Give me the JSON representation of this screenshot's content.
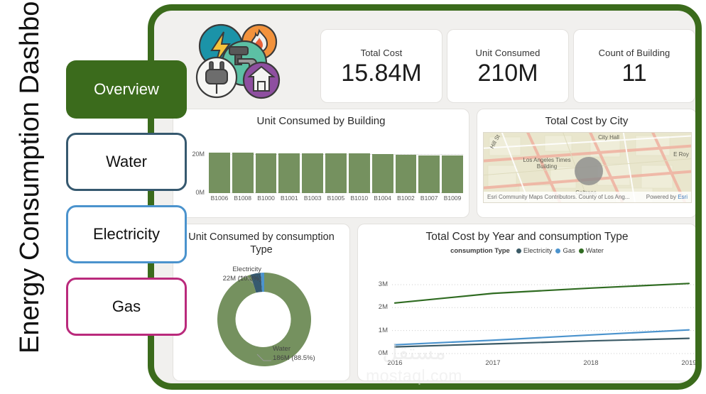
{
  "page": {
    "title": "Energy Consumption Dashboard"
  },
  "nav": {
    "items": [
      {
        "label": "Overview",
        "state": "active",
        "color": "#3b6b1c"
      },
      {
        "label": "Water",
        "state": "inactive",
        "color": "#36596f"
      },
      {
        "label": "Electricity",
        "state": "inactive",
        "color": "#4b93cd"
      },
      {
        "label": "Gas",
        "state": "inactive",
        "color": "#ba2a7c"
      }
    ]
  },
  "kpis": [
    {
      "label": "Total Cost",
      "value": "15.84M"
    },
    {
      "label": "Unit Consumed",
      "value": "210M"
    },
    {
      "label": "Count of Building",
      "value": "11"
    }
  ],
  "icon_cluster": {
    "icons": [
      "lightning-bolt-icon",
      "flame-icon",
      "faucet-icon",
      "plug-icon",
      "house-icon"
    ],
    "colors": [
      "#1b93a8",
      "#f2923c",
      "#5cc0a4",
      "#f6f6f4",
      "#8e4fa0"
    ]
  },
  "map_panel": {
    "title": "Total Cost by City",
    "labels": [
      "City Hall",
      "Los Angeles Times Building",
      "Caltrans",
      "Hill St",
      "E Roy"
    ],
    "attribution": "Esri Community Maps Contributors. County of Los Ang...",
    "powered_by": "Powered by",
    "powered_by_link": "Esri"
  },
  "watermark": {
    "arabic": "مستقل",
    "latin": "mostaql.com"
  },
  "chart_data": [
    {
      "type": "bar",
      "title": "Unit Consumed by Building",
      "xlabel": "",
      "ylabel": "",
      "ylim": [
        0,
        22000000
      ],
      "ytick_labels": [
        "0M",
        "20M"
      ],
      "ytick_values": [
        0,
        20000000
      ],
      "grid": true,
      "categories": [
        "B1006",
        "B1008",
        "B1000",
        "B1001",
        "B1003",
        "B1005",
        "B1010",
        "B1004",
        "B1002",
        "B1007",
        "B1009"
      ],
      "values": [
        20.3,
        20.2,
        19.9,
        19.9,
        19.8,
        19.8,
        19.7,
        19.6,
        19.1,
        18.9,
        18.9
      ],
      "value_unit": "M",
      "series_color": "#75915f"
    },
    {
      "type": "pie",
      "title": "Unit Consumed by consumption Type",
      "hole": 0.55,
      "legend": "none",
      "categories": [
        "Water",
        "Electricity",
        "Gas"
      ],
      "values": [
        186,
        22,
        2.6
      ],
      "value_unit": "M",
      "percents": [
        88.5,
        10.3,
        1.2
      ],
      "colors": [
        "#75915f",
        "#36596f",
        "#4b93cd"
      ],
      "labels": [
        {
          "name": "Electricity",
          "text": "22M (10.3%)"
        },
        {
          "name": "Water",
          "text": "186M (88.5%)"
        }
      ]
    },
    {
      "type": "line",
      "title": "Total Cost by Year and consumption Type",
      "legend_title": "consumption Type",
      "legend_position": "top",
      "xlabel": "",
      "ylabel": "",
      "x": [
        "2016",
        "2017",
        "2018",
        "2019"
      ],
      "ylim": [
        0,
        3400000
      ],
      "ytick_labels": [
        "0M",
        "1M",
        "2M",
        "3M"
      ],
      "ytick_values": [
        0,
        1000000,
        2000000,
        3000000
      ],
      "grid": true,
      "series": [
        {
          "name": "Electricity",
          "color": "#3b5a66",
          "values": [
            0.29,
            0.42,
            0.55,
            0.66
          ]
        },
        {
          "name": "Gas",
          "color": "#4b93cd",
          "values": [
            0.38,
            0.58,
            0.81,
            1.03
          ]
        },
        {
          "name": "Water",
          "color": "#2f6b21",
          "values": [
            2.2,
            2.62,
            2.85,
            3.05
          ]
        }
      ],
      "value_unit": "M"
    }
  ]
}
